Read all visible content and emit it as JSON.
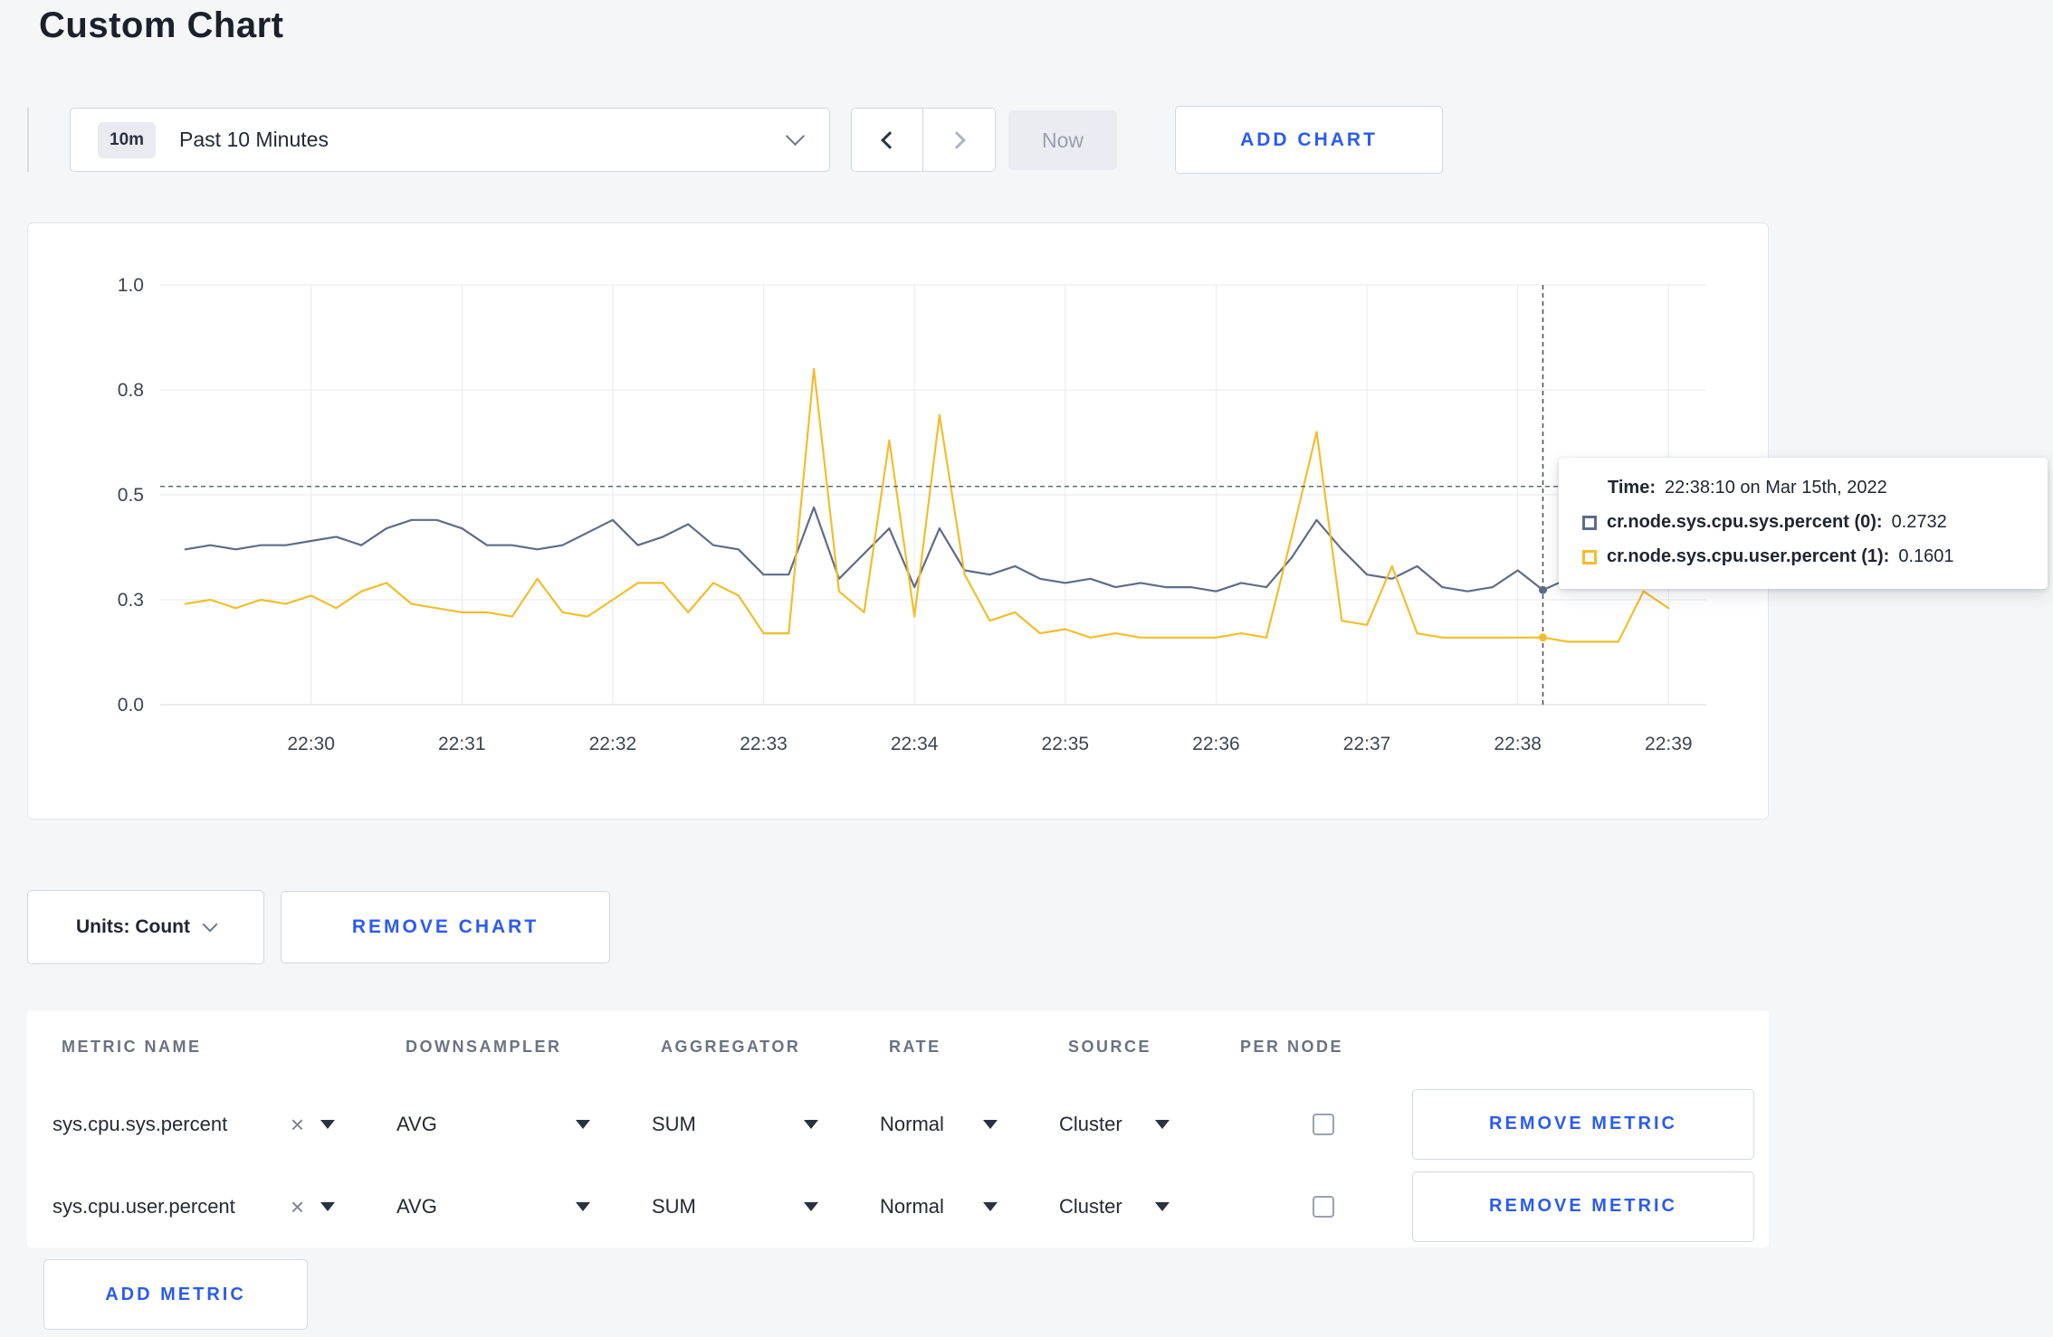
{
  "page": {
    "title": "Custom Chart"
  },
  "colors": {
    "accent_blue": "#2b5bf0",
    "series_sys": "#5f6c87",
    "series_user": "#f2be2c",
    "crosshair": "#444e5e"
  },
  "toolbar": {
    "time_selector": {
      "badge": "10m",
      "label": "Past 10 Minutes"
    },
    "now_button": "Now",
    "add_chart_button": "ADD CHART"
  },
  "tooltip": {
    "time_label": "Time:",
    "time_value": "22:38:10 on Mar 15th, 2022",
    "series": [
      {
        "label": "cr.node.sys.cpu.sys.percent (0):",
        "value": "0.2732",
        "color": "#5f6c87"
      },
      {
        "label": "cr.node.sys.cpu.user.percent (1):",
        "value": "0.1601",
        "color": "#f2be2c"
      }
    ]
  },
  "chart_controls": {
    "units_button": "Units: Count",
    "remove_chart_button": "REMOVE CHART"
  },
  "metrics_table": {
    "headers": [
      "METRIC NAME",
      "DOWNSAMPLER",
      "AGGREGATOR",
      "RATE",
      "SOURCE",
      "PER NODE"
    ],
    "clear_icon": "×",
    "rows": [
      {
        "metric": "sys.cpu.sys.percent",
        "downsampler": "AVG",
        "aggregator": "SUM",
        "rate": "Normal",
        "source": "Cluster",
        "per_node": false,
        "remove_label": "REMOVE METRIC"
      },
      {
        "metric": "sys.cpu.user.percent",
        "downsampler": "AVG",
        "aggregator": "SUM",
        "rate": "Normal",
        "source": "Cluster",
        "per_node": false,
        "remove_label": "REMOVE METRIC"
      }
    ],
    "add_metric_button": "ADD METRIC"
  },
  "chart_data": {
    "type": "line",
    "title": "",
    "xlabel": "",
    "ylabel": "",
    "ylim": [
      0,
      1
    ],
    "grid": true,
    "legend_position": "none",
    "x_start": "22:29:10",
    "x_step_seconds": 10,
    "x_domain": [
      "22:29:00",
      "22:39:15"
    ],
    "x_tick_labels": [
      "22:30",
      "22:31",
      "22:32",
      "22:33",
      "22:34",
      "22:35",
      "22:36",
      "22:37",
      "22:38",
      "22:39"
    ],
    "y_ticks": [
      {
        "label": "1.0",
        "value": 1.0
      },
      {
        "label": "0.8",
        "value": 0.75
      },
      {
        "label": "0.5",
        "value": 0.5
      },
      {
        "label": "0.3",
        "value": 0.25
      },
      {
        "label": "0.0",
        "value": 0.0
      }
    ],
    "series": [
      {
        "name": "cr.node.sys.cpu.sys.percent",
        "color": "#5f6c87",
        "values": [
          0.37,
          0.38,
          0.37,
          0.38,
          0.38,
          0.39,
          0.4,
          0.38,
          0.42,
          0.44,
          0.44,
          0.42,
          0.38,
          0.38,
          0.37,
          0.38,
          0.41,
          0.44,
          0.38,
          0.4,
          0.43,
          0.38,
          0.37,
          0.31,
          0.31,
          0.47,
          0.3,
          0.36,
          0.42,
          0.28,
          0.42,
          0.32,
          0.31,
          0.33,
          0.3,
          0.29,
          0.3,
          0.28,
          0.29,
          0.28,
          0.28,
          0.27,
          0.29,
          0.28,
          0.35,
          0.44,
          0.37,
          0.31,
          0.3,
          0.33,
          0.28,
          0.27,
          0.28,
          0.32,
          0.2732,
          0.3,
          0.32,
          0.3,
          0.29,
          0.3
        ]
      },
      {
        "name": "cr.node.sys.cpu.user.percent",
        "color": "#f2be2c",
        "values": [
          0.24,
          0.25,
          0.23,
          0.25,
          0.24,
          0.26,
          0.23,
          0.27,
          0.29,
          0.24,
          0.23,
          0.22,
          0.22,
          0.21,
          0.3,
          0.22,
          0.21,
          0.25,
          0.29,
          0.29,
          0.22,
          0.29,
          0.26,
          0.17,
          0.17,
          0.8,
          0.27,
          0.22,
          0.63,
          0.21,
          0.69,
          0.31,
          0.2,
          0.22,
          0.17,
          0.18,
          0.16,
          0.17,
          0.16,
          0.16,
          0.16,
          0.16,
          0.17,
          0.16,
          0.4,
          0.65,
          0.2,
          0.19,
          0.33,
          0.17,
          0.16,
          0.16,
          0.16,
          0.16,
          0.1601,
          0.15,
          0.15,
          0.15,
          0.27,
          0.23
        ]
      }
    ],
    "crosshair": {
      "time": "22:38:10",
      "hline_value": 0.52,
      "points": [
        {
          "series": 0,
          "value": 0.2732
        },
        {
          "series": 1,
          "value": 0.1601
        }
      ]
    }
  }
}
